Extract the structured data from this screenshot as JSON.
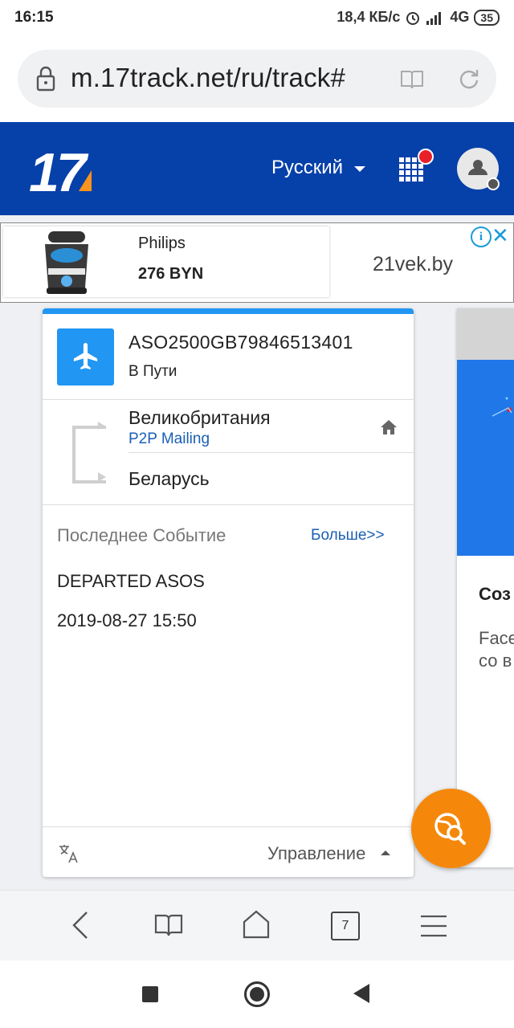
{
  "status_bar": {
    "time": "16:15",
    "network_speed": "18,4 КБ/с",
    "network_type": "4G",
    "battery": "35",
    "icons": [
      "alarm-icon",
      "signal-icon",
      "battery-icon"
    ]
  },
  "browser": {
    "url": "m.17track.net/ru/track#",
    "tab_count": "7",
    "icons": [
      "lock-icon",
      "reader-mode-icon",
      "reload-icon",
      "back-icon",
      "bookmarks-icon",
      "home-icon",
      "tabs-icon",
      "menu-icon"
    ]
  },
  "header": {
    "logo_text": "17",
    "language": "Русский",
    "colors": {
      "header_bg": "#0640a9",
      "logo_accent": "#f7931e",
      "notification_dot": "#e8202a"
    }
  },
  "ad": {
    "brand": "Philips",
    "price": "276 BYN",
    "site": "21vek.by",
    "info_symbol": "i",
    "close_symbol": "✕"
  },
  "tracking_card": {
    "tracking_number": "ASO2500GB79846513401",
    "status": "В Пути",
    "origin_country": "Великобритания",
    "carrier": "P2P Mailing",
    "destination_country": "Беларусь",
    "last_event_label": "Последнее Событие",
    "more_link": "Больше>>",
    "last_event": "DEPARTED ASOS",
    "last_event_date": "2019-08-27 15:50",
    "manage_label": "Управление",
    "colors": {
      "accent": "#2196f3",
      "link": "#1a5fb4"
    }
  },
  "side_card": {
    "title_partial": "Соз",
    "text_line1_partial": "Face",
    "text_line2_partial": "со в"
  },
  "fab": {
    "icon": "global-search-icon",
    "color": "#f5880a"
  }
}
